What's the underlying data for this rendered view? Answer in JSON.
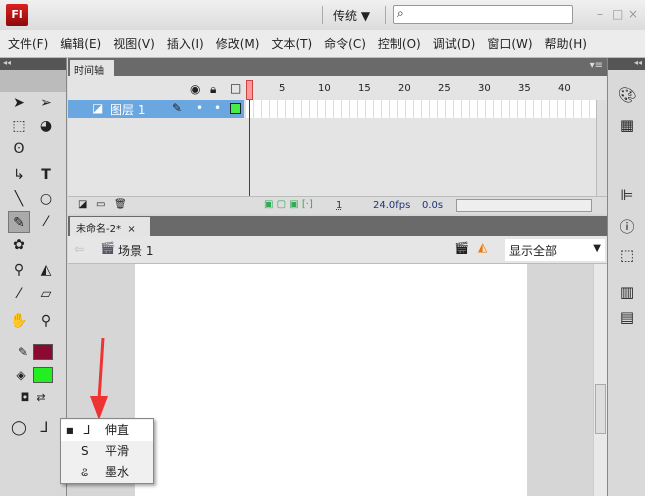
{
  "app": {
    "logo": "Fl",
    "workspace": "传统 ▼",
    "search_placeholder": ""
  },
  "window_buttons": [
    "–",
    "□",
    "×"
  ],
  "menu": [
    "文件(F)",
    "编辑(E)",
    "视图(V)",
    "插入(I)",
    "修改(M)",
    "文本(T)",
    "命令(C)",
    "控制(O)",
    "调试(D)",
    "窗口(W)",
    "帮助(H)"
  ],
  "timeline": {
    "tab": "时间轴",
    "layer_name": "图层 1",
    "ruler": [
      "1",
      "5",
      "10",
      "15",
      "20",
      "25",
      "30",
      "35",
      "40"
    ],
    "current_frame": "1",
    "fps": "24.0fps",
    "time": "0.0s"
  },
  "document": {
    "tab": "未命名-2*",
    "close": "×",
    "scene": "场景 1",
    "zoom": "显示全部"
  },
  "colors": {
    "stroke": "#8b0a32",
    "fill": "#22ee22",
    "accent_layer": "#6aa7e0"
  },
  "pencil_mode_menu": {
    "items": [
      {
        "label": "伸直",
        "icon": "straighten-icon",
        "selected": true
      },
      {
        "label": "平滑",
        "icon": "smooth-icon",
        "selected": false
      },
      {
        "label": "墨水",
        "icon": "ink-icon",
        "selected": false
      }
    ]
  }
}
